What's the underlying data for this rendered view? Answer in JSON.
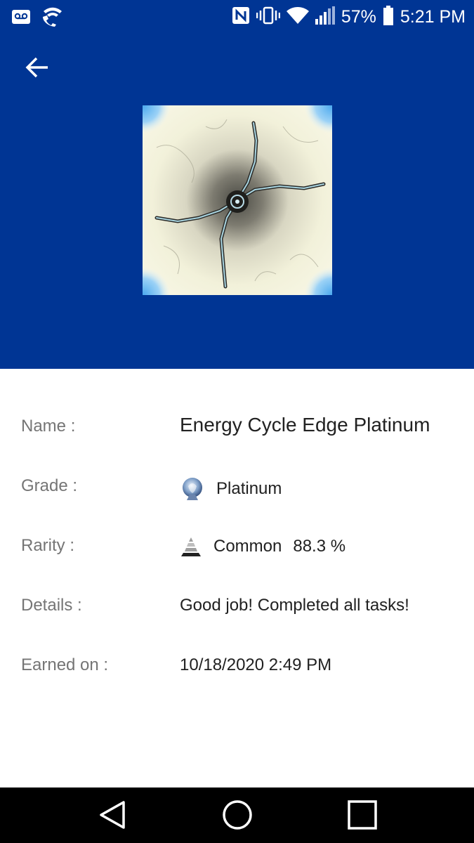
{
  "status_bar": {
    "battery_percent": "57%",
    "time": "5:21 PM",
    "icons": [
      "voicemail-icon",
      "wifi-call-icon",
      "nfc-icon",
      "vibrate-icon",
      "wifi-icon",
      "signal-icon",
      "battery-icon"
    ]
  },
  "header": {
    "back_icon": "arrow-left-icon",
    "background_color": "#003594"
  },
  "details": {
    "name_label": "Name :",
    "name_value": "Energy Cycle Edge Platinum",
    "grade_label": "Grade :",
    "grade_value": "Platinum",
    "grade_icon": "platinum-trophy-icon",
    "rarity_label": "Rarity :",
    "rarity_value": "Common",
    "rarity_percent": "88.3 %",
    "rarity_icon": "pyramid-icon",
    "details_label": "Details :",
    "details_value": "Good job! Completed all tasks!",
    "earned_label": "Earned on :",
    "earned_value": "10/18/2020 2:49 PM"
  },
  "nav_bar": {
    "back": "back-triangle-icon",
    "home": "home-circle-icon",
    "recents": "recents-square-icon"
  }
}
